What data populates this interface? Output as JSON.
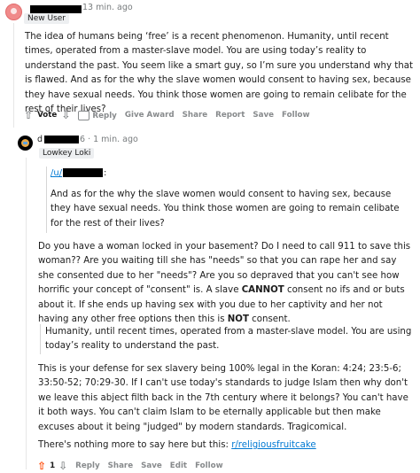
{
  "comment1": {
    "time": "13 min. ago",
    "flair": "New User",
    "body": "The idea of humans being ‘free’ is a recent phenomenon. Humanity, until recent times, operated from a master-slave model. You are using today’s reality to understand the past. You seem like a smart guy, so I’m sure you understand why that is flawed. And as for the why the slave women would consent to having sex, because they have sexual needs. You think those women are going to remain celibate for the rest of their lives?",
    "actions": {
      "vote": "Vote",
      "reply": "Reply",
      "give_award": "Give Award",
      "share": "Share",
      "report": "Report",
      "save": "Save",
      "follow": "Follow"
    }
  },
  "comment2": {
    "user_prefix": "d",
    "user_suffix": "6",
    "time": "· 1 min. ago",
    "flair": "Lowkey Loki",
    "quote1": {
      "user_link": "/u/",
      "colon": ":",
      "text": "And as for the why the slave women would consent to having sex, because they have sexual needs. You think those women are going to remain celibate for the rest of their lives?"
    },
    "para1": {
      "a": "Do you have a woman locked in your basement? Do I need to call 911 to save this woman?? Are you waiting till she has \"needs\" so that you can rape her and say she consented due to her \"needs\"? Are you so depraved that you can't see how horrific your concept of \"consent\" is. A slave ",
      "b": "CANNOT",
      "c": " consent no ifs and or buts about it. If she ends up having sex with you due to her captivity and her not having any other free options then this is ",
      "d": "NOT",
      "e": " consent."
    },
    "quote2": "Humanity, until recent times, operated from a master-slave model. You are using today’s reality to understand the past.",
    "para2": "This is your defense for sex slavery being 100% legal in the Koran: 4:24; 23:5-6; 33:50-52; 70:29-30. If I can't use today's standards to judge Islam then why don't we leave this abject filth back in the 7th century where it belongs? You can't have it both ways. You can't claim Islam to be eternally applicable but then make excuses about it being \"judged\" by modern standards. Tragicomical.",
    "para3": {
      "text": "There's nothing more to say here but this: ",
      "link": "r/religiousfruitcake"
    },
    "actions": {
      "score": "1",
      "reply": "Reply",
      "share": "Share",
      "save": "Save",
      "edit": "Edit",
      "follow": "Follow"
    }
  },
  "colors": {
    "accent_link": "#0079d3",
    "upvote": "#ff4500",
    "muted": "#878a8c"
  }
}
